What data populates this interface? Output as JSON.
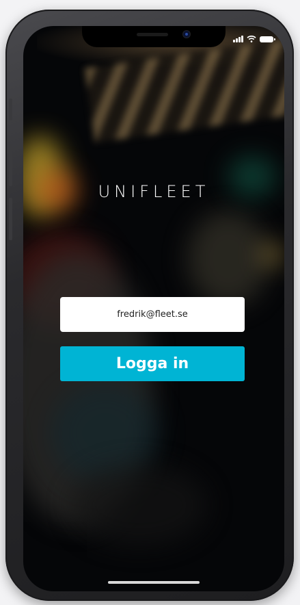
{
  "app": {
    "brand": "UNIFLEET"
  },
  "login": {
    "email_value": "fredrik@fleet.se",
    "button_label": "Logga in"
  },
  "colors": {
    "accent": "#00b4d4",
    "field_bg": "#ffffff",
    "screen_bg": "#050608"
  },
  "status_bar": {
    "icons": [
      "signal-icon",
      "wifi-icon",
      "battery-icon"
    ]
  }
}
